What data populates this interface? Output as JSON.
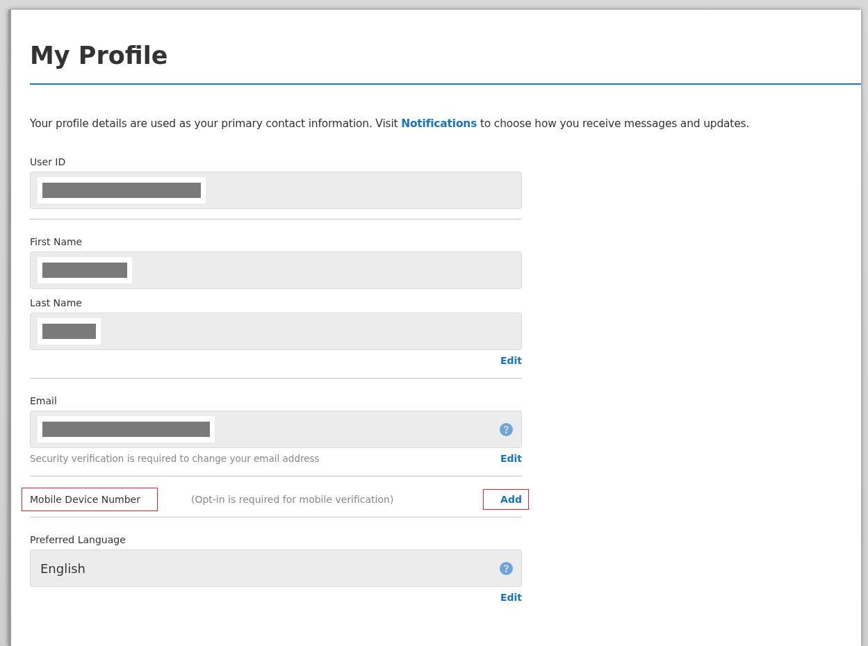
{
  "title": "My Profile",
  "intro": {
    "before": "Your profile details are used as your primary contact information. Visit",
    "link": "Notifications",
    "after": "to choose how you receive messages and updates."
  },
  "sections": [
    {
      "kind": "fields",
      "fields": [
        {
          "label": "User ID",
          "redacted": true,
          "help": false
        }
      ]
    },
    {
      "kind": "fields",
      "fields": [
        {
          "label": "First Name",
          "redacted": true,
          "help": false
        },
        {
          "label": "Last Name",
          "redacted": true,
          "help": false
        }
      ],
      "action": {
        "label": "Edit",
        "highlighted": false
      }
    },
    {
      "kind": "fields",
      "fields": [
        {
          "label": "Email",
          "redacted": true,
          "help": true
        }
      ],
      "note": "Security verification is required to change your email address",
      "action": {
        "label": "Edit",
        "highlighted": false
      }
    },
    {
      "kind": "inline",
      "label": "Mobile Device Number",
      "label_highlighted": true,
      "note": "(Opt-in is required for mobile verification)",
      "action": {
        "label": "Add",
        "highlighted": true
      }
    },
    {
      "kind": "fields",
      "fields": [
        {
          "label": "Preferred Language",
          "value": "English",
          "redacted": false,
          "help": true
        }
      ],
      "action": {
        "label": "Edit",
        "highlighted": false
      }
    }
  ]
}
